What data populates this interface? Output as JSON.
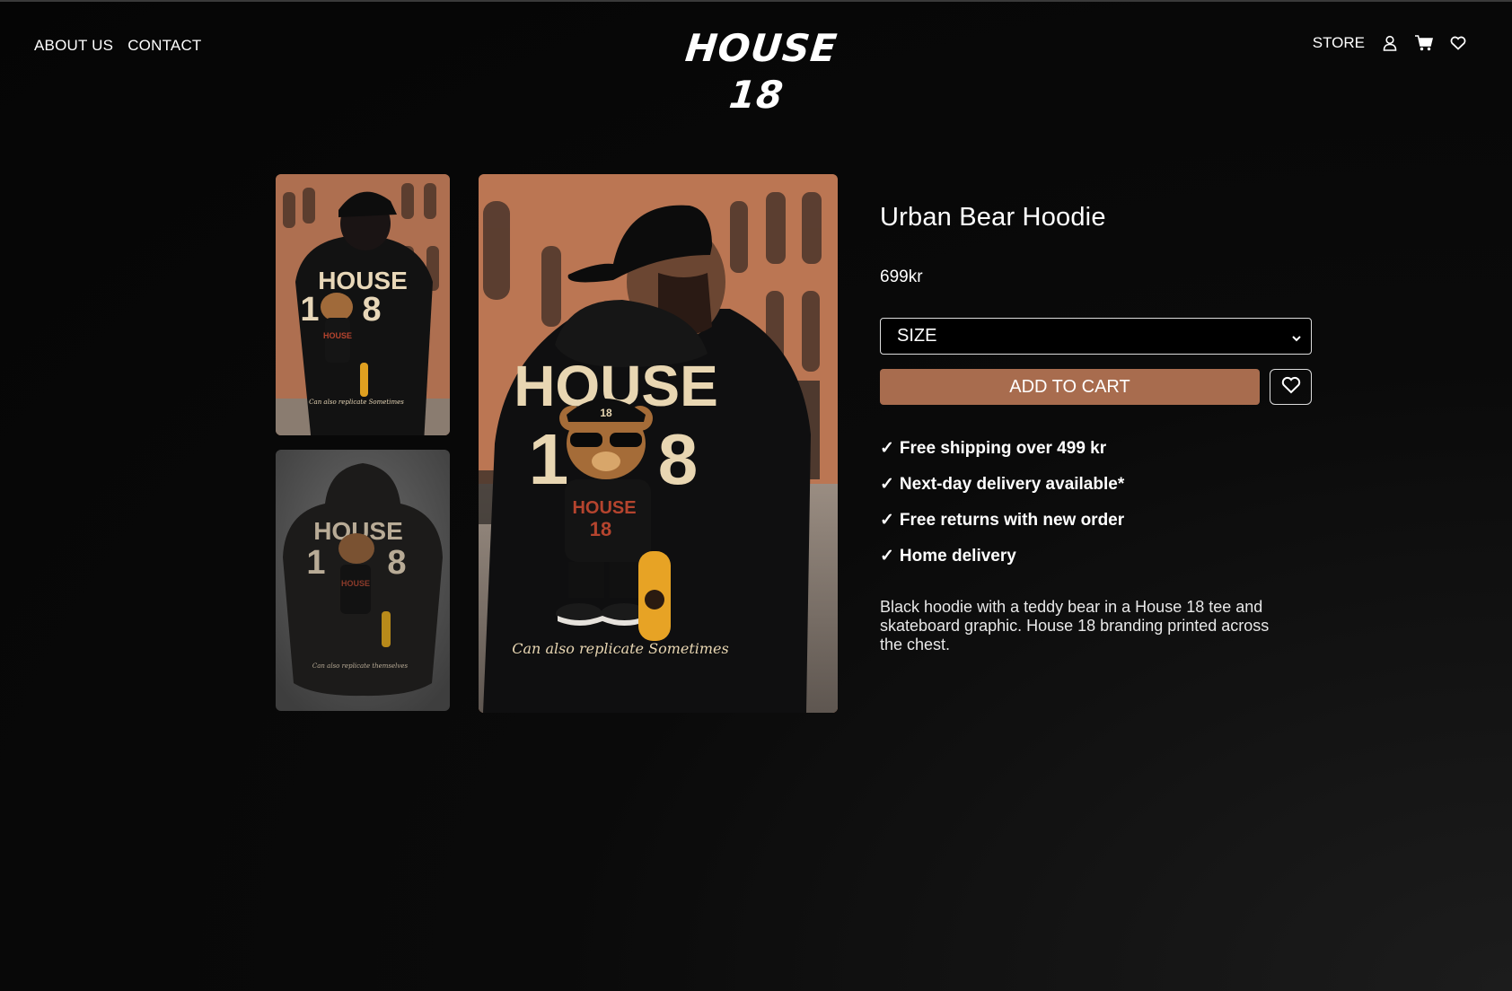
{
  "nav": {
    "left": [
      {
        "label": "ABOUT US"
      },
      {
        "label": "CONTACT"
      }
    ],
    "logo": "HOUSE 18",
    "store_label": "STORE",
    "icons": [
      "user-icon",
      "cart-icon",
      "heart-icon"
    ]
  },
  "gallery": {
    "print_top": "HOUSE",
    "print_num_left": "1",
    "print_num_right": "8",
    "shirt_text": "HOUSE",
    "shirt_num": "18",
    "cap_num": "18",
    "tagline_main": "Can also replicate Sometimes",
    "tagline_alt": "Can also replicate themselves"
  },
  "product": {
    "title": "Urban Bear Hoodie",
    "price": "699kr",
    "size_placeholder": "SIZE",
    "add_to_cart_label": "ADD TO CART",
    "features": [
      {
        "check": "✓",
        "text": "Free shipping over 499 kr"
      },
      {
        "check": "✓",
        "text": "Next-day delivery available*"
      },
      {
        "check": "✓",
        "text": "Free returns with new order"
      },
      {
        "check": "✓",
        "text": "Home delivery"
      }
    ],
    "description": "Black hoodie with a teddy bear in a House 18 tee and skateboard graphic. House 18 branding printed across the chest."
  },
  "colors": {
    "background": "#050505",
    "accent_button": "#a86c4e",
    "text": "#ffffff"
  }
}
